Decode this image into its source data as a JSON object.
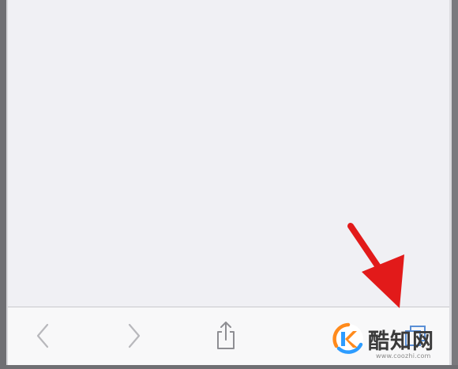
{
  "toolbar": {
    "buttons": [
      {
        "name": "back",
        "icon": "chevron-left-icon",
        "enabled": false
      },
      {
        "name": "forward",
        "icon": "chevron-right-icon",
        "enabled": false
      },
      {
        "name": "share",
        "icon": "share-icon",
        "enabled": true
      },
      {
        "name": "tabs",
        "icon": "tabs-icon",
        "enabled": true
      }
    ]
  },
  "annotation": {
    "icon": "red-arrow-icon",
    "color": "#e21a1a"
  },
  "watermark": {
    "brand": "酷知网",
    "url": "www.coozhi.com",
    "logo_icon": "k-logo-icon",
    "logo_colors": [
      "#ff8a1c",
      "#2d9cff"
    ]
  },
  "colors": {
    "page_background": "#f0f0f4",
    "toolbar_background": "#f8f8f9",
    "icon_disabled": "#b8b8bc",
    "icon_enabled": "#8e8e93"
  }
}
